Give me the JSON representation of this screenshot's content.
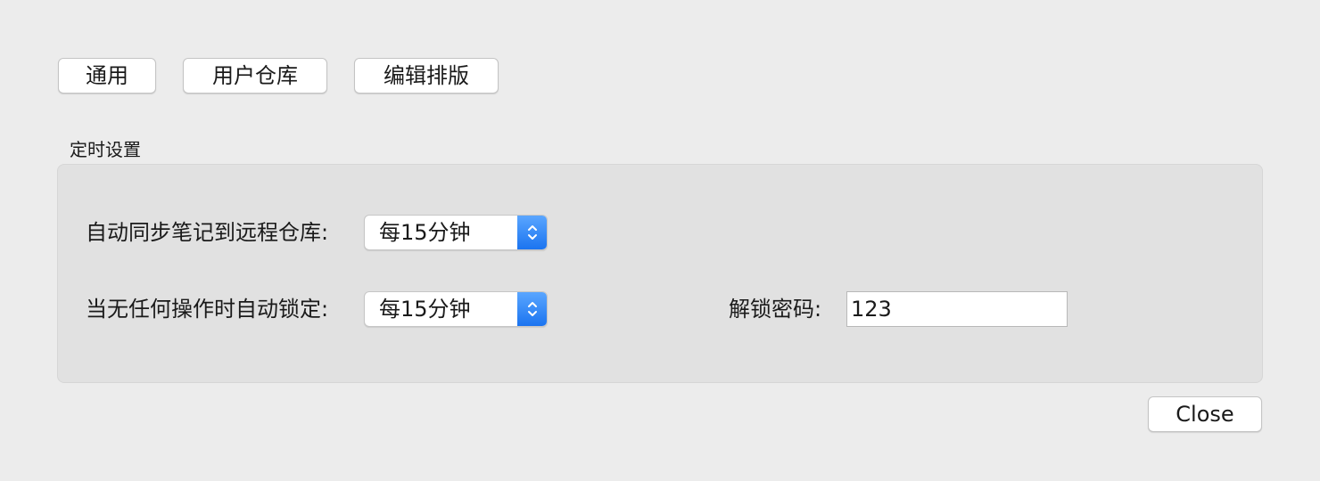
{
  "tabs": {
    "general": "通用",
    "user_repo": "用户仓库",
    "editor_layout": "编辑排版"
  },
  "timer_settings": {
    "title": "定时设置",
    "sync_label": "自动同步笔记到远程仓库:",
    "sync_value": "每15分钟",
    "lock_label": "当无任何操作时自动锁定:",
    "lock_value": "每15分钟",
    "password_label": "解锁密码:",
    "password_value": "123"
  },
  "footer": {
    "close_label": "Close"
  },
  "colors": {
    "accent": "#1b74f0",
    "window_bg": "#ececec",
    "group_bg": "#e1e1e1"
  },
  "icons": {
    "select_arrow": "chevron-up-down-icon"
  }
}
